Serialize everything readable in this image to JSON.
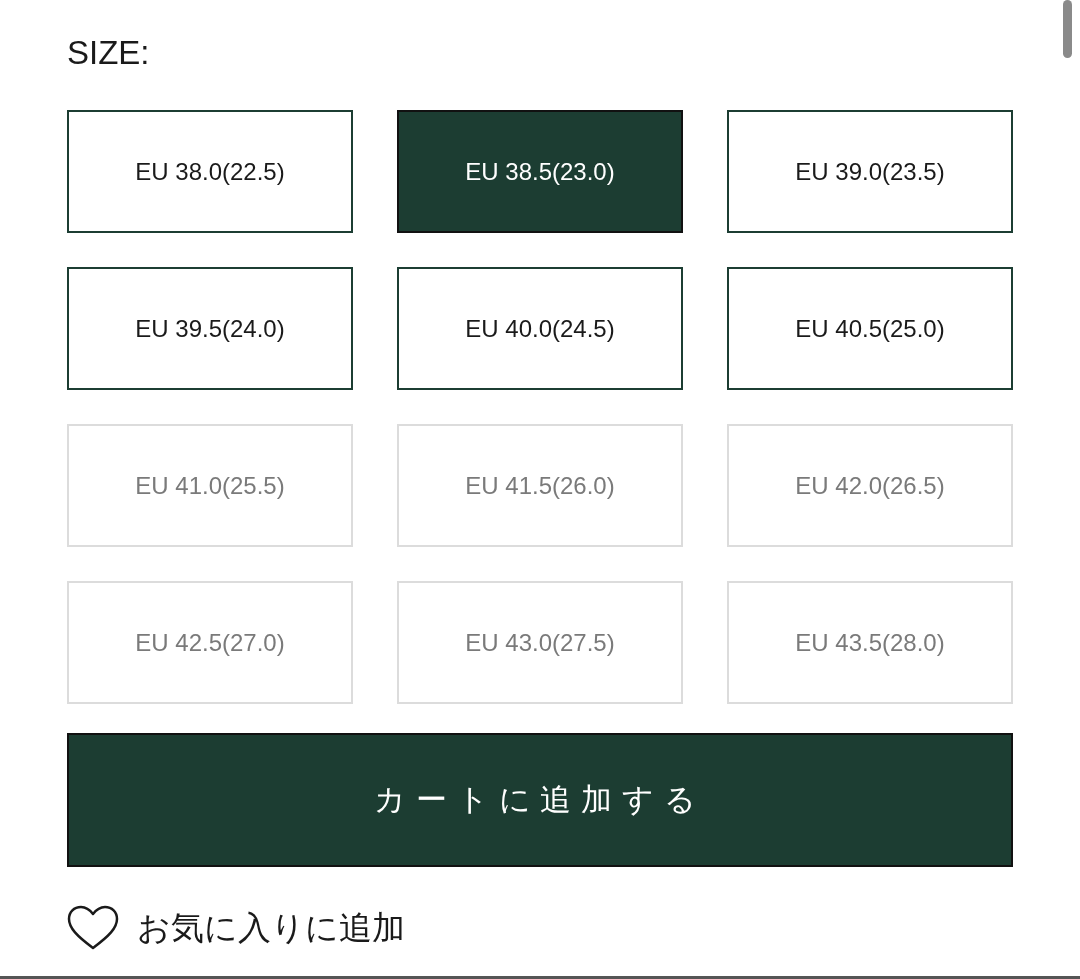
{
  "heading": "SIZE:",
  "sizes": [
    {
      "label": "EU 38.0(22.5)",
      "selected": false,
      "disabled": false
    },
    {
      "label": "EU 38.5(23.0)",
      "selected": true,
      "disabled": false
    },
    {
      "label": "EU 39.0(23.5)",
      "selected": false,
      "disabled": false
    },
    {
      "label": "EU 39.5(24.0)",
      "selected": false,
      "disabled": false
    },
    {
      "label": "EU 40.0(24.5)",
      "selected": false,
      "disabled": false
    },
    {
      "label": "EU 40.5(25.0)",
      "selected": false,
      "disabled": false
    },
    {
      "label": "EU 41.0(25.5)",
      "selected": false,
      "disabled": true
    },
    {
      "label": "EU 41.5(26.0)",
      "selected": false,
      "disabled": true
    },
    {
      "label": "EU 42.0(26.5)",
      "selected": false,
      "disabled": true
    },
    {
      "label": "EU 42.5(27.0)",
      "selected": false,
      "disabled": true
    },
    {
      "label": "EU 43.0(27.5)",
      "selected": false,
      "disabled": true
    },
    {
      "label": "EU 43.5(28.0)",
      "selected": false,
      "disabled": true
    }
  ],
  "add_to_cart": "カートに追加する",
  "favorite": "お気に入りに追加"
}
